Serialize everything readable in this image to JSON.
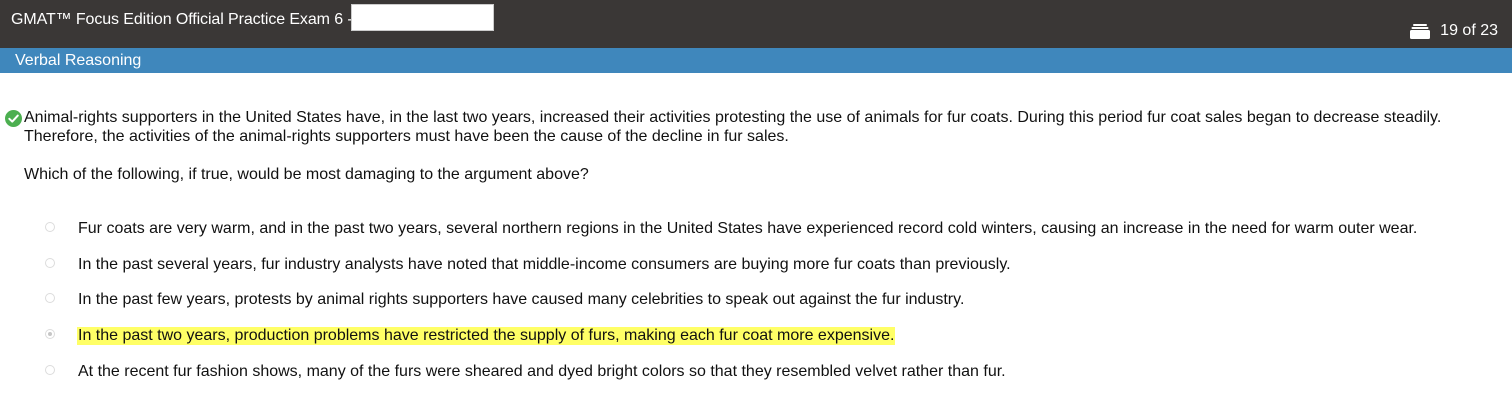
{
  "header": {
    "title": "GMAT™ Focus Edition Official Practice Exam 6 -",
    "name_value": "",
    "progress": "19 of 23",
    "progress_icon": "question-list-icon"
  },
  "section": {
    "title": "Verbal Reasoning"
  },
  "question": {
    "status_icon": "check-circle-icon",
    "status_color": "#4caf50",
    "passage": "Animal-rights supporters in the United States have, in the last two years, increased their activities protesting the use of animals for fur coats. During this period fur coat sales began to decrease steadily. Therefore, the activities of the animal-rights supporters must have been the cause of the decline in fur sales.",
    "stem": "Which of the following, if true, would be most damaging to the argument above?",
    "options": [
      {
        "text": "Fur coats are very warm, and in the past two years, several northern regions in the United States have experienced record cold winters, causing an increase in the need for warm outer wear.",
        "selected": false,
        "highlighted": false
      },
      {
        "text": "In the past several years, fur industry analysts have noted that middle-income consumers are buying more fur coats than previously.",
        "selected": false,
        "highlighted": false
      },
      {
        "text": "In the past few years, protests by animal rights supporters have caused many celebrities to speak out against the fur industry.",
        "selected": false,
        "highlighted": false
      },
      {
        "text": "In the past two years, production problems have restricted the supply of furs, making each fur coat more expensive.",
        "selected": true,
        "highlighted": true
      },
      {
        "text": "At the recent fur fashion shows, many of the furs were sheared and dyed bright colors so that they resembled velvet rather than fur.",
        "selected": false,
        "highlighted": false
      }
    ],
    "highlight_color": "#ffff66"
  }
}
